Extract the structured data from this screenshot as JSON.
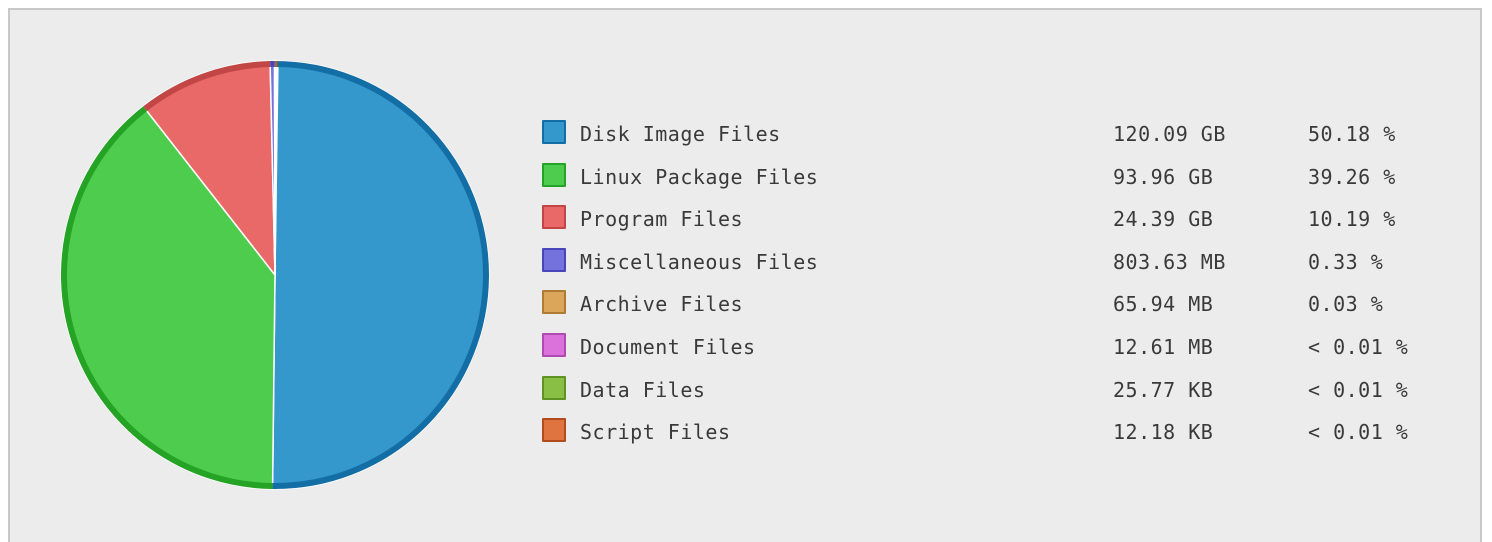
{
  "chart_data": {
    "type": "pie",
    "slices": [
      {
        "label": "Disk Image Files",
        "size": "120.09 GB",
        "percent_text": "50.18 %",
        "value": 50.18,
        "color": "#3498cc",
        "edge": "#146ea6"
      },
      {
        "label": "Linux Package Files",
        "size": "93.96 GB",
        "percent_text": "39.26 %",
        "value": 39.26,
        "color": "#4ecc4e",
        "edge": "#25a325"
      },
      {
        "label": "Program Files",
        "size": "24.39 GB",
        "percent_text": "10.19 %",
        "value": 10.19,
        "color": "#e96969",
        "edge": "#c24646"
      },
      {
        "label": "Miscellaneous Files",
        "size": "803.63 MB",
        "percent_text": "0.33 %",
        "value": 0.33,
        "color": "#7472dd",
        "edge": "#4846b8"
      },
      {
        "label": "Archive Files",
        "size": "65.94 MB",
        "percent_text": "0.03 %",
        "value": 0.03,
        "color": "#dba659",
        "edge": "#b07c33"
      },
      {
        "label": "Document Files",
        "size": "12.61 MB",
        "percent_text": "< 0.01 %",
        "value": 0.005,
        "color": "#db72db",
        "edge": "#b04ab0"
      },
      {
        "label": "Data Files",
        "size": "25.77 KB",
        "percent_text": "< 0.01 %",
        "value": 0.001,
        "color": "#89bf45",
        "edge": "#5f9424"
      },
      {
        "label": "Script Files",
        "size": "12.18 KB",
        "percent_text": "< 0.01 %",
        "value": 0.0005,
        "color": "#df7440",
        "edge": "#b04c1e"
      }
    ]
  }
}
